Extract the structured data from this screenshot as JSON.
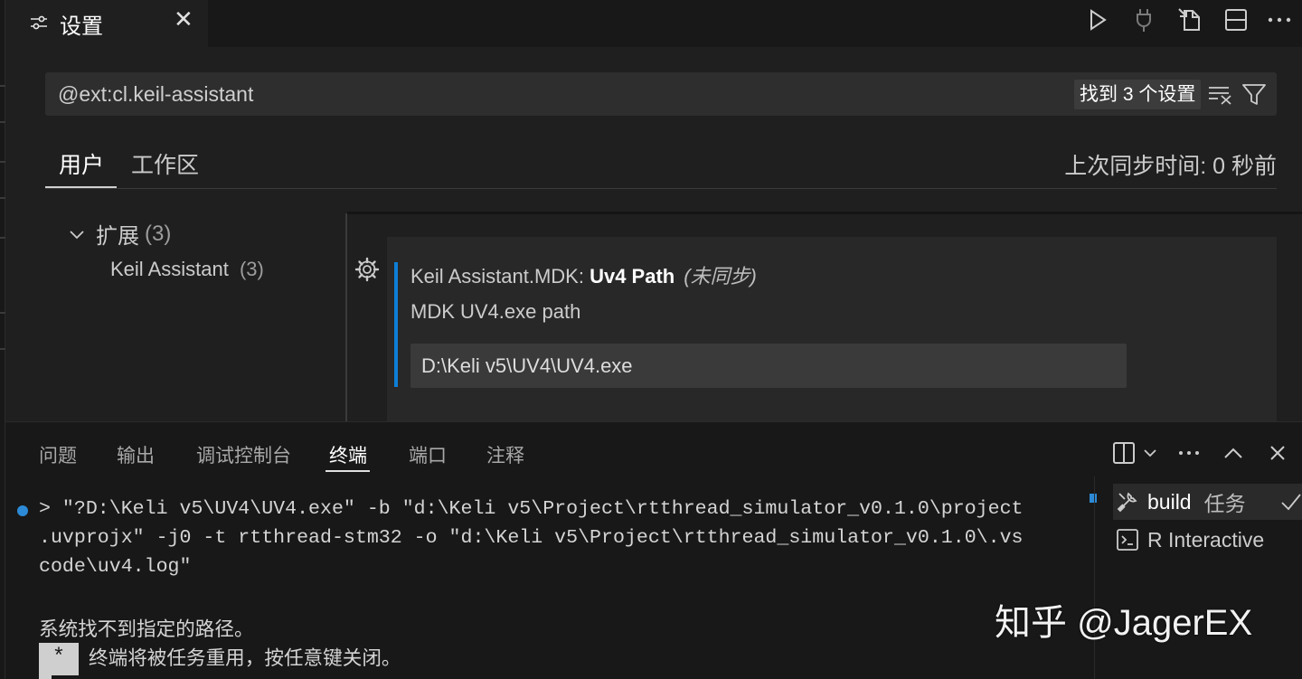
{
  "editor_tab": {
    "icon": "settings-sliders-icon",
    "title": "设置",
    "close_icon": "close-icon"
  },
  "editor_actions": [
    {
      "name": "run-icon"
    },
    {
      "name": "plug-icon"
    },
    {
      "name": "open-settings-json-icon"
    },
    {
      "name": "split-editor-icon"
    },
    {
      "name": "more-actions-icon"
    }
  ],
  "settings": {
    "search": {
      "value": "@ext:cl.keil-assistant",
      "result_count": "找到 3 个设置",
      "clear_icon": "clear-filter-icon",
      "filter_icon": "filter-icon"
    },
    "scope_tabs": [
      {
        "label": "用户",
        "active": true
      },
      {
        "label": "工作区",
        "active": false
      }
    ],
    "sync_status": "上次同步时间: 0 秒前",
    "toc": {
      "header": "扩展",
      "header_count": "(3)",
      "item": "Keil Assistant",
      "item_count": "(3)"
    },
    "item": {
      "category": "Keil Assistant.MDK: ",
      "name": "Uv4 Path",
      "sync_note": "(未同步)",
      "description": "MDK UV4.exe path",
      "value": "D:\\Keli v5\\UV4\\UV4.exe"
    }
  },
  "panel": {
    "tabs": [
      "问题",
      "输出",
      "调试控制台",
      "终端",
      "端口",
      "注释"
    ],
    "active_tab": "终端",
    "terminal": {
      "lines": [
        "> \"?D:\\Keli v5\\UV4\\UV4.exe\" -b \"d:\\Keli v5\\Project\\rtthread_simulator_v0.1.0\\project",
        ".uvprojx\" -j0 -t rtthread-stm32 -o \"d:\\Keli v5\\Project\\rtthread_simulator_v0.1.0\\.vs",
        "code\\uv4.log\"",
        "",
        "系统找不到指定的路径。",
        "终端将被任务重用，按任意键关闭。"
      ],
      "star": "*"
    },
    "terminal_list": [
      {
        "label": "build",
        "suffix": "任务",
        "icon": "tools-icon",
        "selected": true
      },
      {
        "label": "R Interactive",
        "suffix": "",
        "icon": "terminal-icon",
        "selected": false
      }
    ]
  },
  "watermark": "知乎 @JagerEX",
  "colors": {
    "accent": "#0e7fd6",
    "background": "#1f1f1f",
    "panel": "#181818"
  }
}
